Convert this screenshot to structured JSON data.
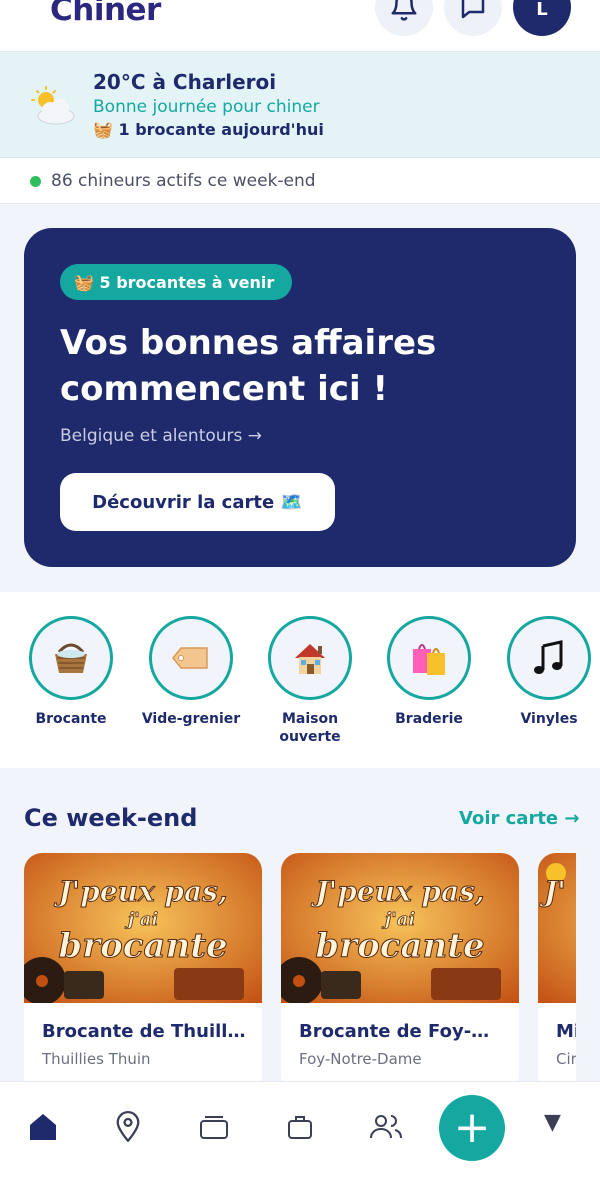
{
  "app": {
    "name": "Chiner"
  },
  "header": {
    "avatar_initial": "L",
    "icons": [
      "bell-icon",
      "chat-icon"
    ]
  },
  "weather": {
    "title": "20°C à Charleroi",
    "subtitle": "Bonne journée pour chiner",
    "today": "🧺 1 brocante aujourd'hui",
    "icon": "partly-cloudy-icon"
  },
  "activity": {
    "text": "86 chineurs actifs ce week-end",
    "dot_color": "#2ec05a"
  },
  "hero": {
    "badge": "🧺 5 brocantes à venir",
    "title": "Vos bonnes affaires commencent ici !",
    "subtitle": "Belgique et alentours →",
    "cta": "Découvrir la carte 🗺️"
  },
  "categories": [
    {
      "label": "Brocante",
      "icon": "🧺"
    },
    {
      "label": "Vide-grenier",
      "icon": "🏷️"
    },
    {
      "label": "Maison ouverte",
      "icon": "🏠"
    },
    {
      "label": "Braderie",
      "icon": "🛍️"
    },
    {
      "label": "Vinyles",
      "icon": "🎵"
    }
  ],
  "weekend": {
    "title": "Ce week-end",
    "link": "Voir carte →",
    "poster_text": [
      "J'peux pas,",
      "j'ai",
      "brocante"
    ],
    "cards": [
      {
        "title": "Brocante de Thuillies",
        "location": "Thuillies Thuin"
      },
      {
        "title": "Brocante de Foy-Notre-Dame",
        "location": "Foy-Notre-Dame"
      },
      {
        "title": "Mi",
        "location": "Cir"
      }
    ]
  },
  "bottom_nav": {
    "items": [
      "home-icon",
      "map-pin-icon",
      "cards-icon",
      "bag-icon",
      "users-icon"
    ],
    "fab": "+",
    "more": "▼"
  },
  "colors": {
    "navy": "#1e2a6b",
    "teal": "#15a8a0",
    "bg": "#f2f4fb"
  }
}
